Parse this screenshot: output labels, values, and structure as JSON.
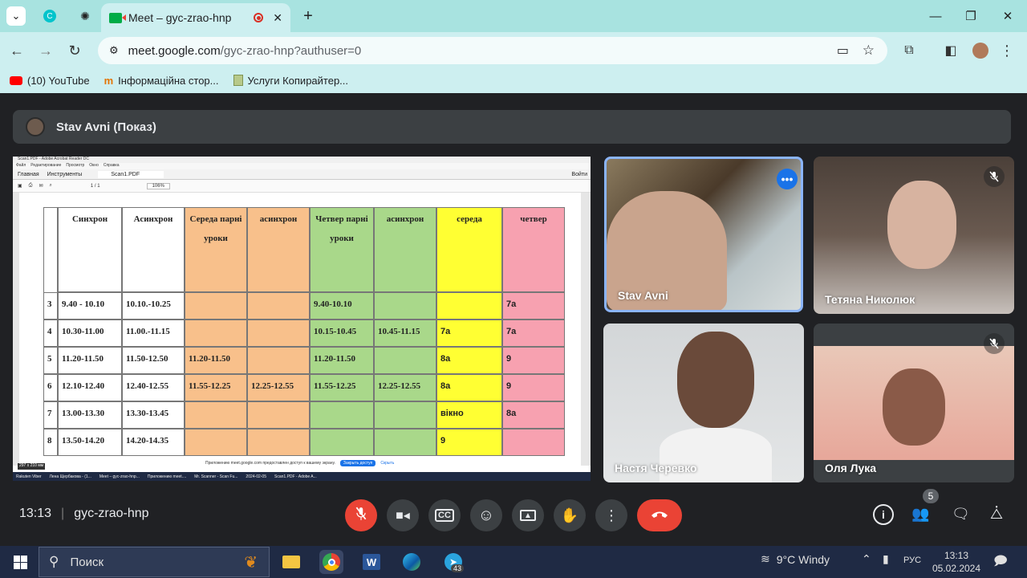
{
  "browser": {
    "active_tab_title": "Meet – gyc-zrao-hnp",
    "url_host": "meet.google.com",
    "url_path": "/gyc-zrao-hnp?authuser=0",
    "bookmarks": [
      "(10) YouTube",
      "Інформаційна стор...",
      "Услуги Копирайтер..."
    ]
  },
  "meet": {
    "presenter_label": "Stav Avni (Показ)",
    "time": "13:13",
    "meeting_code": "gyc-zrao-hnp",
    "participants_count": "5",
    "participants": [
      {
        "name": "Stav Avni",
        "active": true,
        "muted": false
      },
      {
        "name": "Тетяна Николюк",
        "muted": true
      },
      {
        "name": "Настя Черевко",
        "muted": false
      },
      {
        "name": "Оля Лука",
        "muted": true
      }
    ],
    "colors": {
      "end_call": "#ea4335",
      "muted_mic": "#ea4335",
      "active_border": "#8ab4f8"
    }
  },
  "shared_doc": {
    "app_title": "Scan1.PDF - Adobe Acrobat Reader DC",
    "menu": [
      "Файл",
      "Редактирование",
      "Просмотр",
      "Окно",
      "Справка"
    ],
    "tabs": [
      "Главная",
      "Инструменты",
      "Scan1.PDF"
    ],
    "zoom": "106%",
    "page": "1 / 1",
    "login": "Войти",
    "headers": [
      "Синхрон",
      "Асинхрон",
      "Середа парні уроки",
      "асинхрон",
      "Четвер парні уроки",
      "асинхрон",
      "середа",
      "четвер"
    ],
    "rows": [
      [
        "3",
        "9.40 - 10.10",
        "10.10.-10.25",
        "",
        "",
        "9.40-10.10",
        "",
        "",
        "7а"
      ],
      [
        "4",
        "10.30-11.00",
        "11.00.-11.15",
        "",
        "",
        "10.15-10.45",
        "10.45-11.15",
        "7а",
        "7а"
      ],
      [
        "5",
        "11.20-11.50",
        "11.50-12.50",
        "11.20-11.50",
        "",
        "11.20-11.50",
        "",
        "8а",
        "9"
      ],
      [
        "6",
        "12.10-12.40",
        "12.40-12.55",
        "11.55-12.25",
        "12.25-12.55",
        "11.55-12.25",
        "12.25-12.55",
        "8а",
        "9"
      ],
      [
        "7",
        "13.00-13.30",
        "13.30-13.45",
        "",
        "",
        "",
        "",
        "вікно",
        "8а"
      ],
      [
        "8",
        "13.50-14.20",
        "14.20-14.35",
        "",
        "",
        "",
        "",
        "9",
        ""
      ]
    ],
    "col_colors": [
      "#ffffff",
      "#ffffff",
      "#f8c08b",
      "#f8c08b",
      "#a9d88a",
      "#a9d88a",
      "#ffff33",
      "#f7a1b0"
    ],
    "size_label": "297 x 210 мм",
    "notice": "Приложению meet.google.com предоставлен доступ к вашему экрану.",
    "stop_share": "Закрыть доступ",
    "hide": "Скрыть",
    "taskbar_items": [
      "Rakuten Viber",
      "Лена Щербакова - (1...",
      "Meet – gyc-zrao-hnp...",
      "Приложению meet....",
      "Mr. Scanner - Scan Fu...",
      "2024-02-05",
      "Scan1.PDF - Adobe A..."
    ]
  },
  "taskbar": {
    "search_placeholder": "Поиск",
    "weather": "9°C  Windy",
    "lang": "РУС",
    "time": "13:13",
    "date": "05.02.2024",
    "telegram_badge": "43"
  }
}
